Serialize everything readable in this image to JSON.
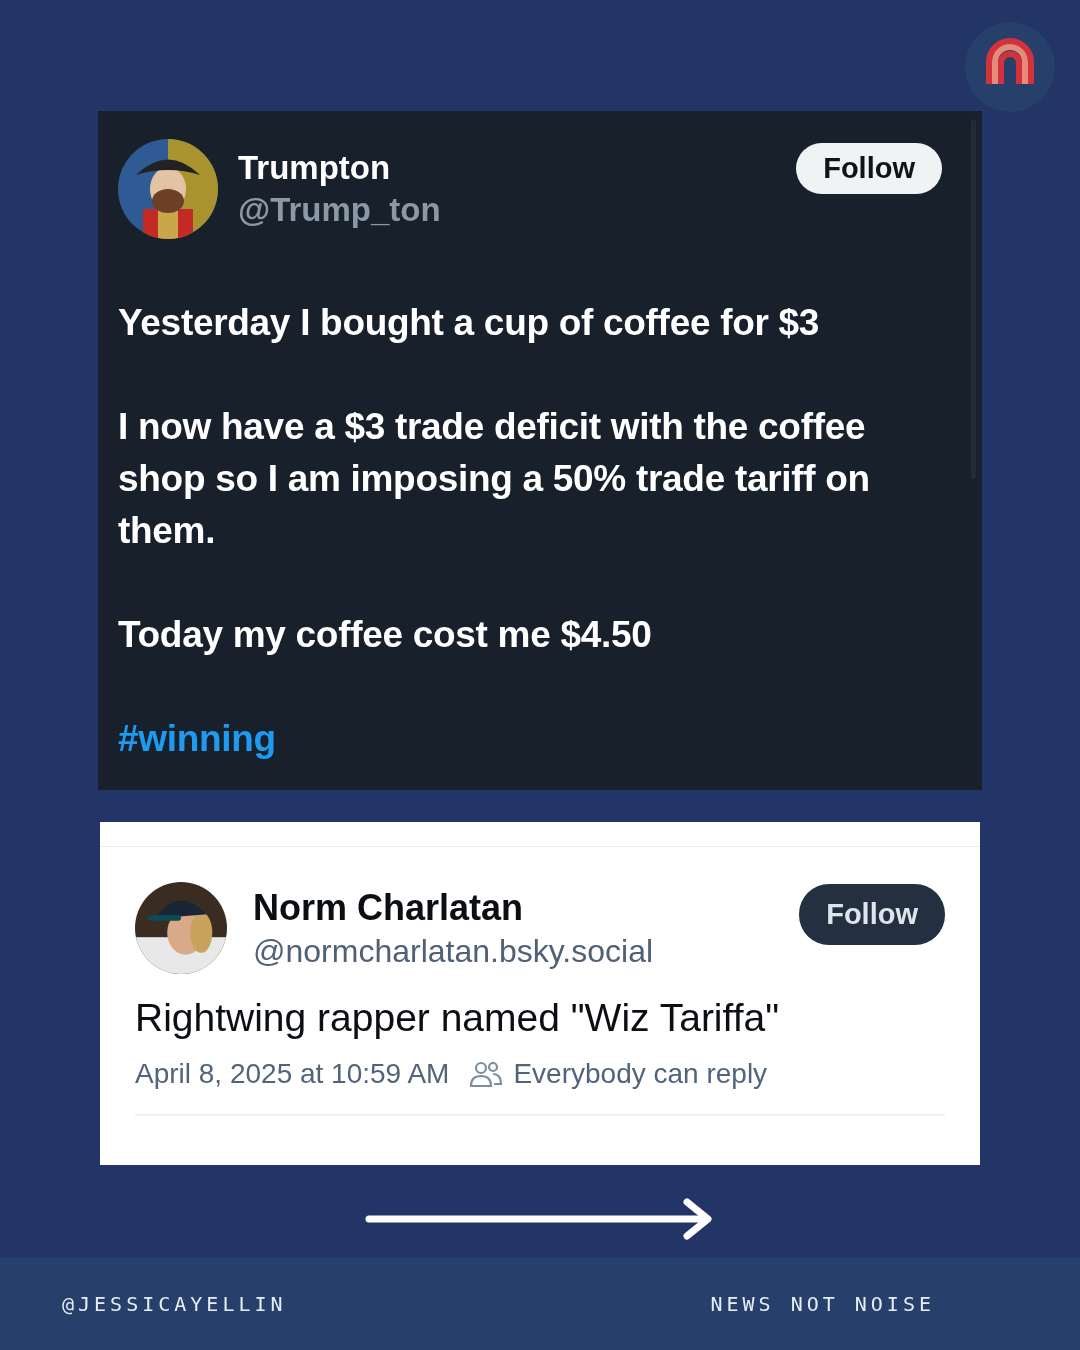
{
  "top_post": {
    "name": "Trumpton",
    "handle": "@Trump_ton",
    "follow": "Follow",
    "paragraphs": [
      {
        "kind": "text",
        "text": "Yesterday I bought a cup of coffee for $3"
      },
      {
        "kind": "text",
        "text": "I now have a $3 trade deficit with the coffee shop so I am imposing a 50% trade tariff on them."
      },
      {
        "kind": "text",
        "text": "Today my coffee cost me $4.50"
      },
      {
        "kind": "hashtag",
        "text": "#winning"
      }
    ]
  },
  "bottom_post": {
    "name": "Norm Charlatan",
    "handle": "@normcharlatan.bsky.social",
    "follow": "Follow",
    "text": "Rightwing rapper named \"Wiz Tariffa\"",
    "timestamp": "April 8, 2025 at 10:59 AM",
    "reply_setting": "Everybody can reply"
  },
  "footer": {
    "account": "@JESSICAYELLIN",
    "tagline": "NEWS NOT NOISE"
  }
}
